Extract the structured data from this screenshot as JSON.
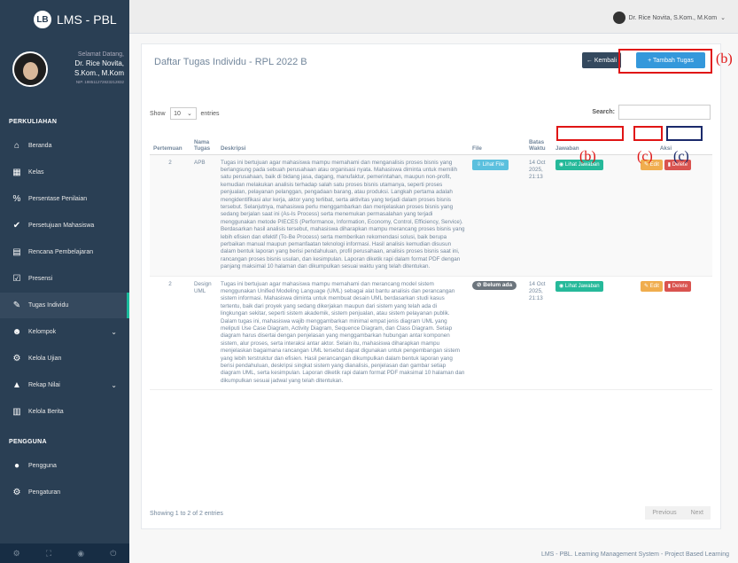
{
  "app": {
    "name": "LMS - PBL",
    "logo_text": "LB"
  },
  "profile": {
    "welcome": "Selamat Datang,",
    "name_line1": "Dr. Rice Novita,",
    "name_line2": "S.Kom., M.Kom",
    "nip": "NIP. 198511272823212832"
  },
  "sidebar": {
    "section1": "PERKULIAHAN",
    "section2": "PENGGUNA",
    "items": [
      {
        "label": "Beranda",
        "icon": "home-icon",
        "glyph": "⌂"
      },
      {
        "label": "Kelas",
        "icon": "building-icon",
        "glyph": "▦"
      },
      {
        "label": "Persentase Penilaian",
        "icon": "percent-icon",
        "glyph": "%"
      },
      {
        "label": "Persetujuan Mahasiswa",
        "icon": "check-circle-icon",
        "glyph": "✔"
      },
      {
        "label": "Rencana Pembelajaran",
        "icon": "file-icon",
        "glyph": "▤"
      },
      {
        "label": "Presensi",
        "icon": "check-square-icon",
        "glyph": "☑"
      },
      {
        "label": "Tugas Individu",
        "icon": "edit-icon",
        "glyph": "✎"
      },
      {
        "label": "Kelompok",
        "icon": "users-icon",
        "glyph": "☻"
      },
      {
        "label": "Kelola Ujian",
        "icon": "cogs-icon",
        "glyph": "⚙"
      },
      {
        "label": "Rekap Nilai",
        "icon": "graduation-icon",
        "glyph": "▲"
      },
      {
        "label": "Kelola Berita",
        "icon": "newspaper-icon",
        "glyph": "▥"
      },
      {
        "label": "Pengguna",
        "icon": "user-icon",
        "glyph": "●"
      },
      {
        "label": "Pengaturan",
        "icon": "gear-icon",
        "glyph": "⚙"
      }
    ],
    "footer_icons": [
      "⚙",
      "⛶",
      "◉",
      "⏻"
    ]
  },
  "topbar": {
    "user": "Dr. Rice Novita, S.Kom., M.Kom",
    "caret": "⌄"
  },
  "panel": {
    "title": "Daftar Tugas Individu - RPL 2022 B",
    "back_label": "← Kembali",
    "add_label": "+ Tambah Tugas",
    "show_label": "Show",
    "entries_value": "10",
    "entries_label": "entries",
    "search_label": "Search:"
  },
  "table": {
    "headers": [
      "Pertemuan",
      "Nama Tugas",
      "Deskripsi",
      "File",
      "Batas Waktu",
      "Jawaban",
      "Aksi"
    ],
    "rows": [
      {
        "pertemuan": "2",
        "nama": "APB",
        "deskripsi": "Tugas ini bertujuan agar mahasiswa mampu memahami dan menganalisis proses bisnis yang berlangsung pada sebuah perusahaan atau organisasi nyata. Mahasiswa diminta untuk memilih satu perusahaan, baik di bidang jasa, dagang, manufaktur, pemerintahan, maupun non-profit, kemudian melakukan analisis terhadap salah satu proses bisnis utamanya, seperti proses penjualan, pelayanan pelanggan, pengadaan barang, atau produksi. Langkah pertama adalah mengidentifikasi alur kerja, aktor yang terlibat, serta aktivitas yang terjadi dalam proses bisnis tersebut. Selanjutnya, mahasiswa perlu menggambarkan dan menjelaskan proses bisnis yang sedang berjalan saat ini (As-Is Process) serta menemukan permasalahan yang terjadi menggunakan metode PIECES (Performance, Information, Economy, Control, Efficiency, Service). Berdasarkan hasil analisis tersebut, mahasiswa diharapkan mampu merancang proses bisnis yang lebih efisien dan efektif (To-Be Process) serta memberikan rekomendasi solusi, baik berupa perbaikan manual maupun pemanfaatan teknologi informasi. Hasil analisis kemudian disusun dalam bentuk laporan yang berisi pendahuluan, profil perusahaan, analisis proses bisnis saat ini, rancangan proses bisnis usulan, dan kesimpulan. Laporan diketik rapi dalam format PDF dengan panjang maksimal 10 halaman dan dikumpulkan sesuai waktu yang telah ditentukan.",
        "file": "⇩ Lihat File",
        "batas": "14 Oct 2025, 21:13",
        "jawaban": "◉ Lihat Jawaban",
        "edit": "✎ Edit",
        "delete": "▮ Delete"
      },
      {
        "pertemuan": "2",
        "nama": "Design UML",
        "deskripsi": "Tugas ini bertujuan agar mahasiswa mampu memahami dan merancang model sistem menggunakan Unified Modeling Language (UML) sebagai alat bantu analisis dan perancangan sistem informasi. Mahasiswa diminta untuk membuat desain UML berdasarkan studi kasus tertentu, baik dari proyek yang sedang dikerjakan maupun dari sistem yang telah ada di lingkungan sekitar, seperti sistem akademik, sistem penjualan, atau sistem pelayanan publik. Dalam tugas ini, mahasiswa wajib menggambarkan minimal empat jenis diagram UML yang meliputi Use Case Diagram, Activity Diagram, Sequence Diagram, dan Class Diagram. Setiap diagram harus disertai dengan penjelasan yang menggambarkan hubungan antar komponen sistem, alur proses, serta interaksi antar aktor. Selain itu, mahasiswa diharapkan mampu menjelaskan bagaimana rancangan UML tersebut dapat digunakan untuk pengembangan sistem yang lebih terstruktur dan efisien. Hasil perancangan dikumpulkan dalam bentuk laporan yang berisi pendahuluan, deskripsi singkat sistem yang dianalisis, penjelasan dan gambar setiap diagram UML, serta kesimpulan. Laporan diketik rapi dalam format PDF maksimal 10 halaman dan dikumpulkan sesuai jadwal yang telah ditentukan.",
        "file": "⊘ Belum ada",
        "batas": "14 Oct 2025, 21:13",
        "jawaban": "◉ Lihat Jawaban",
        "edit": "✎ Edit",
        "delete": "▮ Delete"
      }
    ]
  },
  "showing": "Showing 1 to 2 of 2 entries",
  "pager": {
    "prev": "Previous",
    "next": "Next"
  },
  "footer": "LMS - PBL. Learning Management System - Project Based Learning",
  "annotations": {
    "b": "(b)",
    "c": "(c)"
  },
  "colors": {
    "sidebar": "#2a3f54",
    "accent": "#1abb9c",
    "highlight_red": "#e01515",
    "highlight_navy": "#1b2a6b"
  }
}
